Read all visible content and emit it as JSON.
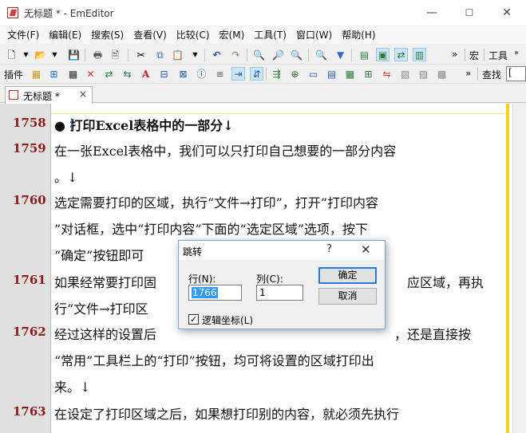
{
  "window": {
    "title": "无标题 * - EmEditor",
    "controls": [
      "—",
      "☐",
      "✕"
    ]
  },
  "menu": [
    "文件(F)",
    "编辑(E)",
    "搜索(S)",
    "查看(V)",
    "比较(C)",
    "宏(M)",
    "工具(T)",
    "窗口(W)",
    "帮助(H)"
  ],
  "toolbar1": {
    "overflow": "»",
    "label_macro": "宏",
    "label_tools": "工具"
  },
  "toolbar2": {
    "label_plugins": "插件",
    "overflow": "»",
    "label_find": "查找",
    "find_value": "["
  },
  "tab": {
    "label": "无标题 *",
    "close": "×"
  },
  "lines": [
    {
      "number": "1758",
      "rows": [
        "● 打印Excel表格中的一部分↓"
      ]
    },
    {
      "number": "1759",
      "rows": [
        "在一张Excel表格中，我们可以只打印自己想要的一部分内容",
        "。↓"
      ]
    },
    {
      "number": "1760",
      "rows": [
        "选定需要打印的区域，执行“文件→打印”，打开“打印内容",
        "”对话框，选中“打印内容”下面的“选定区域”选项，按下",
        "“确定”按钮即可"
      ]
    },
    {
      "number": "1761",
      "rows": [
        "如果经常要打印固",
        "应区域，再执",
        "行“文件→打印区"
      ]
    },
    {
      "number": "1762",
      "rows": [
        "经过这样的设置后",
        "，还是直接按",
        "“常用”工具栏上的“打印”按钮，均可将设置的区域打印出",
        "来。↓"
      ]
    },
    {
      "number": "1763",
      "rows": [
        "在设定了打印区域之后，如果想打印别的内容，就必须先执行"
      ]
    }
  ],
  "dialog": {
    "title": "跳转",
    "help": "?",
    "close": "✕",
    "line_label": "行(N):",
    "line_value": "1766",
    "column_label": "列(C):",
    "column_value": "1",
    "ok": "确定",
    "cancel": "取消",
    "logical_coords_label": "逻辑坐标(L)",
    "logical_coords_checked": "✓"
  },
  "colors": {
    "line_number": "#8b1a1a",
    "wrap_marker": "#f5d21a",
    "newline_mark": "#3a78d8",
    "selection": "#3399ff"
  }
}
